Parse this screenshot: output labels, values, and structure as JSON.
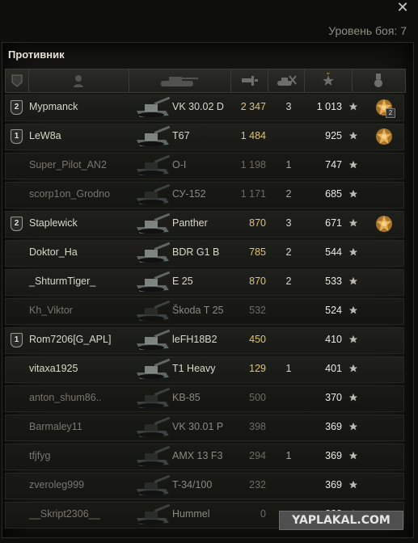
{
  "window": {
    "battle_level": "Уровень боя: 7",
    "close_glyph": "✕"
  },
  "team": {
    "title": "Противник"
  },
  "header": {
    "columns": [
      "platoon-icon",
      "player-icon",
      "tank-icon",
      "damage-icon",
      "kills-icon",
      "xp-star-icon",
      "medal-icon"
    ]
  },
  "players": [
    {
      "platoon": "2",
      "name": "Mypmanck",
      "vehicle": "VK 30.02 D",
      "damage": "2 347",
      "kills": "3",
      "xp": "1 013",
      "medal": true,
      "medal_count": "2",
      "alive": true
    },
    {
      "platoon": "1",
      "name": "LeW8a",
      "vehicle": "T67",
      "damage": "1 484",
      "kills": "",
      "xp": "925",
      "medal": true,
      "medal_count": "",
      "alive": true
    },
    {
      "platoon": "",
      "name": "Super_Pilot_AN2",
      "vehicle": "O-I",
      "damage": "1 198",
      "kills": "1",
      "xp": "747",
      "medal": false,
      "medal_count": "",
      "alive": false
    },
    {
      "platoon": "",
      "name": "scorp1on_Grodno",
      "vehicle": "СУ-152",
      "damage": "1 171",
      "kills": "2",
      "xp": "685",
      "medal": false,
      "medal_count": "",
      "alive": false
    },
    {
      "platoon": "2",
      "name": "Staplewick",
      "vehicle": "Panther",
      "damage": "870",
      "kills": "3",
      "xp": "671",
      "medal": true,
      "medal_count": "",
      "alive": true
    },
    {
      "platoon": "",
      "name": "Doktor_Ha",
      "vehicle": "BDR G1 B",
      "damage": "785",
      "kills": "2",
      "xp": "544",
      "medal": false,
      "medal_count": "",
      "alive": true
    },
    {
      "platoon": "",
      "name": "_ShturmTiger_",
      "vehicle": "E 25",
      "damage": "870",
      "kills": "2",
      "xp": "533",
      "medal": false,
      "medal_count": "",
      "alive": true
    },
    {
      "platoon": "",
      "name": "Kh_Viktor",
      "vehicle": "Škoda T 25",
      "damage": "532",
      "kills": "",
      "xp": "524",
      "medal": false,
      "medal_count": "",
      "alive": false
    },
    {
      "platoon": "1",
      "name": "Rom7206[G_APL]",
      "vehicle": "leFH18B2",
      "damage": "450",
      "kills": "",
      "xp": "410",
      "medal": false,
      "medal_count": "",
      "alive": true
    },
    {
      "platoon": "",
      "name": "vitaxa1925",
      "vehicle": "T1 Heavy",
      "damage": "129",
      "kills": "1",
      "xp": "401",
      "medal": false,
      "medal_count": "",
      "alive": true
    },
    {
      "platoon": "",
      "name": "anton_shum86..",
      "vehicle": "KB-85",
      "damage": "500",
      "kills": "",
      "xp": "370",
      "medal": false,
      "medal_count": "",
      "alive": false
    },
    {
      "platoon": "",
      "name": "Barmaley11",
      "vehicle": "VK 30.01 P",
      "damage": "398",
      "kills": "",
      "xp": "369",
      "medal": false,
      "medal_count": "",
      "alive": false
    },
    {
      "platoon": "",
      "name": "tfjfyg",
      "vehicle": "AMX 13 F3",
      "damage": "294",
      "kills": "1",
      "xp": "369",
      "medal": false,
      "medal_count": "",
      "alive": false
    },
    {
      "platoon": "",
      "name": "zveroleg999",
      "vehicle": "T-34/100",
      "damage": "232",
      "kills": "",
      "xp": "369",
      "medal": false,
      "medal_count": "",
      "alive": false
    },
    {
      "platoon": "",
      "name": "__Skript2306__",
      "vehicle": "Hummel",
      "damage": "0",
      "kills": "",
      "xp": "223",
      "medal": false,
      "medal_count": "",
      "alive": false
    }
  ],
  "watermark": "YAPLAKAL.COM",
  "colors": {
    "damage": "#e3c46a",
    "text": "#dad8cc",
    "dead_text": "#78776e",
    "accent": "#c5a64a"
  }
}
